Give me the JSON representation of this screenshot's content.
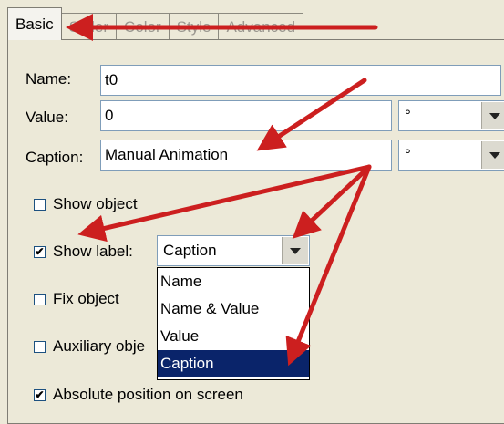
{
  "tabs": [
    {
      "label": "Basic"
    },
    {
      "label": "Slider"
    },
    {
      "label": "Color"
    },
    {
      "label": "Style"
    },
    {
      "label": "Advanced"
    }
  ],
  "name": {
    "label": "Name:",
    "value": "t0"
  },
  "value": {
    "label": "Value:",
    "value": "0",
    "unit": "°"
  },
  "caption": {
    "label": "Caption:",
    "value": "Manual Animation",
    "unit": "°"
  },
  "show_object": {
    "label": "Show object",
    "checked": false
  },
  "show_label": {
    "label": "Show label:",
    "checked": true,
    "selected": "Caption",
    "options": [
      "Name",
      "Name & Value",
      "Value",
      "Caption"
    ]
  },
  "fix_object": {
    "label": "Fix object",
    "checked": false
  },
  "auxiliary_object": {
    "label": "Auxiliary obje",
    "checked": false
  },
  "absolute_position": {
    "label": "Absolute position on screen",
    "checked": true
  },
  "colors": {
    "arrow": "#cc1f1f",
    "selection": "#0a246a"
  }
}
